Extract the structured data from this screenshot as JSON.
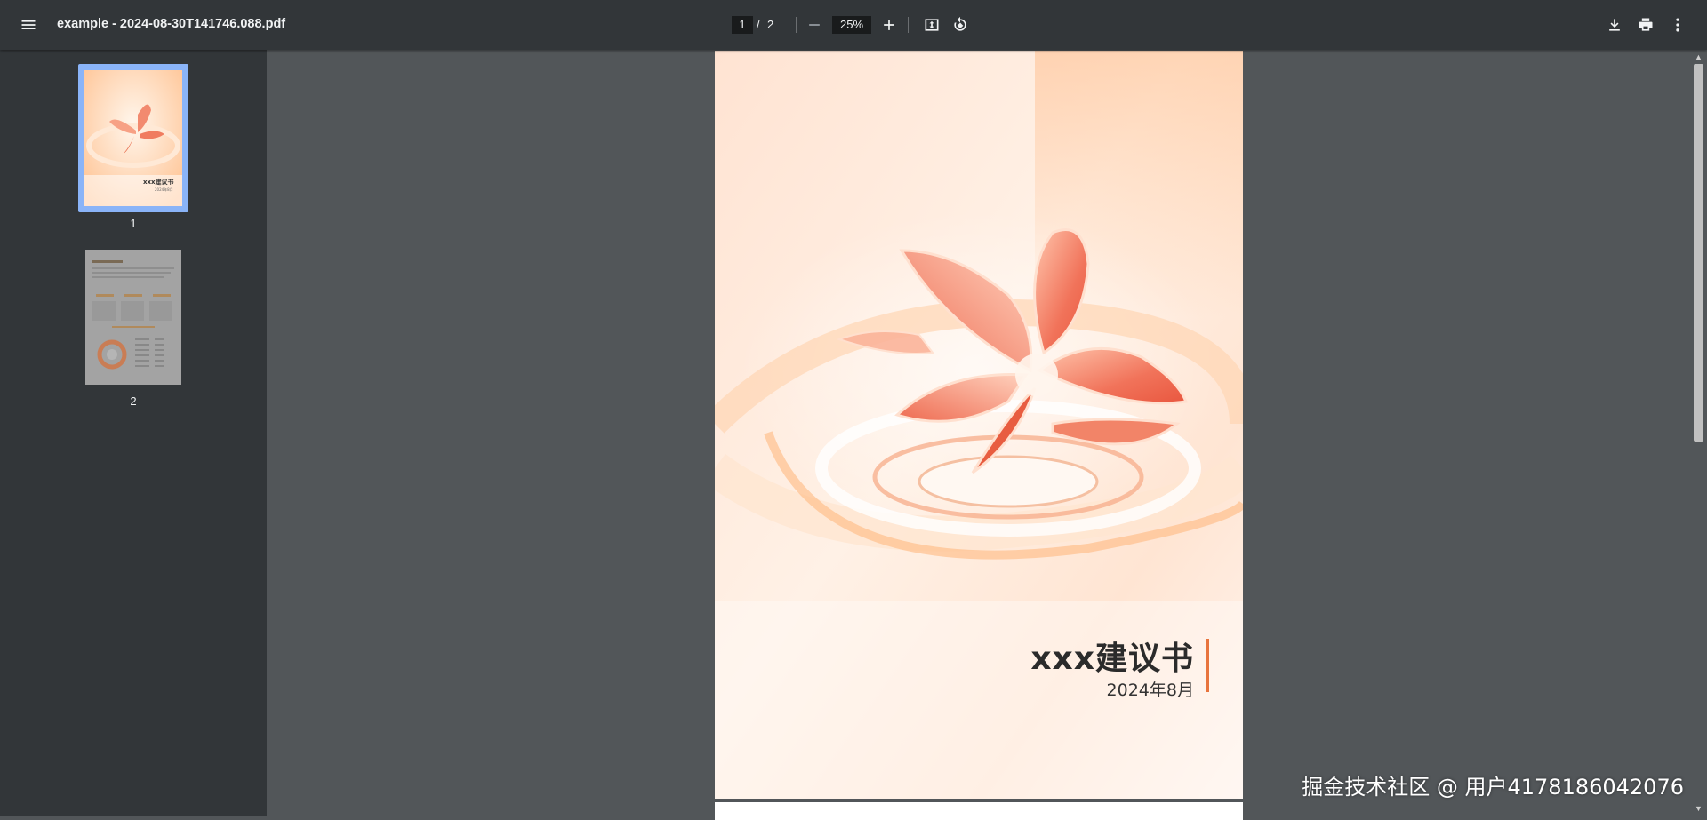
{
  "toolbar": {
    "file_title": "example - 2024-08-30T141746.088.pdf",
    "current_page": "1",
    "page_separator": "/",
    "total_pages": "2",
    "zoom": "25%"
  },
  "sidebar": {
    "thumbnails": [
      {
        "label": "1",
        "selected": true
      },
      {
        "label": "2",
        "selected": false
      }
    ],
    "thumb1_title": "xxx建议书",
    "thumb1_date": "2024年8月"
  },
  "document": {
    "cover_title": "xxx建议书",
    "cover_date": "2024年8月"
  },
  "overlay": {
    "site_watermark": "掘金技术社区 @ 用户4178186042076"
  },
  "colors": {
    "toolbar_bg": "#323639",
    "viewer_bg": "#525659",
    "selected_thumb": "#8ab4f8",
    "accent_bar": "#e8743d"
  }
}
